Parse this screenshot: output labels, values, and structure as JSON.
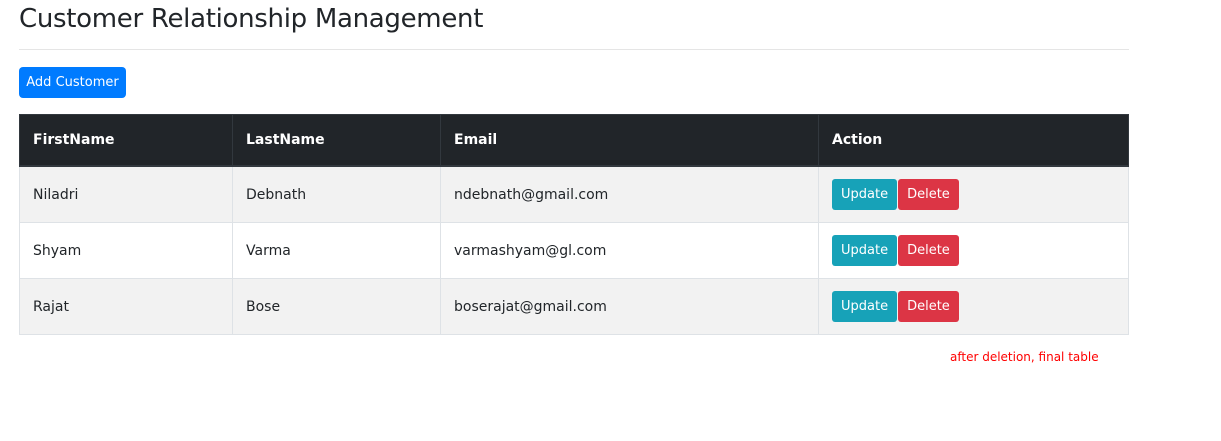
{
  "title": "Customer Relationship Management",
  "add_button": "Add Customer",
  "table": {
    "headers": [
      "FirstName",
      "LastName",
      "Email",
      "Action"
    ],
    "rows": [
      {
        "first": "Niladri",
        "last": "Debnath",
        "email": "ndebnath@gmail.com"
      },
      {
        "first": "Shyam",
        "last": "Varma",
        "email": "varmashyam@gl.com"
      },
      {
        "first": "Rajat",
        "last": "Bose",
        "email": "boserajat@gmail.com"
      }
    ],
    "update_label": "Update",
    "delete_label": "Delete"
  },
  "note": "after deletion, final table",
  "colors": {
    "primary": "#007bff",
    "info": "#17a2b8",
    "danger": "#dc3545",
    "header": "#212529"
  }
}
